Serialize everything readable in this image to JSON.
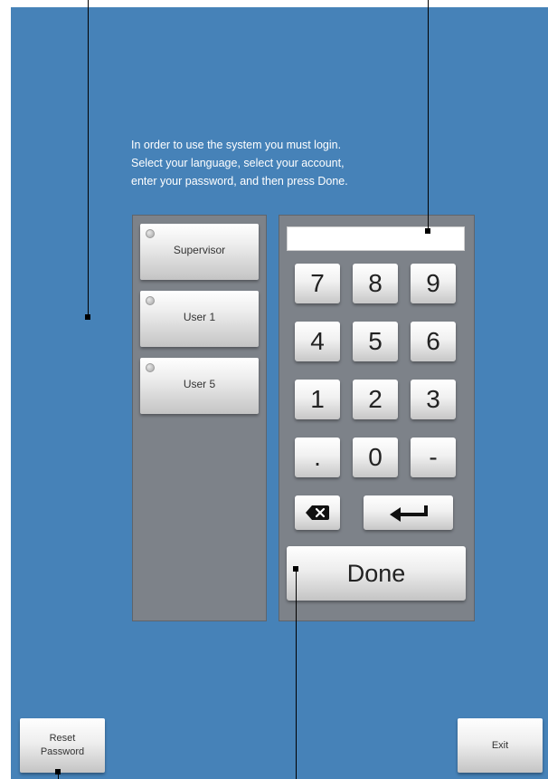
{
  "instructions": {
    "line1": "In order to use the system you must login.",
    "line2": "Select your language, select your account,",
    "line3": "enter your password, and then press Done."
  },
  "accounts": [
    {
      "label": "Supervisor"
    },
    {
      "label": "User 1"
    },
    {
      "label": "User 5"
    }
  ],
  "password": {
    "value": "",
    "placeholder": ""
  },
  "keypad": {
    "k7": "7",
    "k8": "8",
    "k9": "9",
    "k4": "4",
    "k5": "5",
    "k6": "6",
    "k1": "1",
    "k2": "2",
    "k3": "3",
    "kdot": ".",
    "k0": "0",
    "kminus": "-",
    "backspace_icon": "backspace-icon",
    "enter_icon": "enter-icon"
  },
  "done_label": "Done",
  "reset_password": {
    "line1": "Reset",
    "line2": "Password"
  },
  "exit_label": "Exit",
  "colors": {
    "background": "#4682b8",
    "panel": "#7d8289",
    "text": "#ffffff"
  }
}
